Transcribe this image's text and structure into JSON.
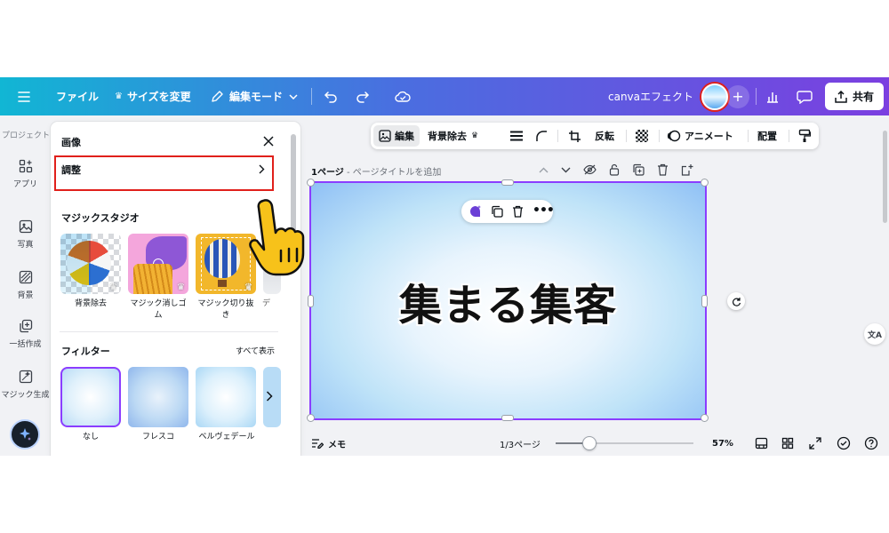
{
  "topbar": {
    "file": "ファイル",
    "resize": "サイズを変更",
    "edit_mode": "編集モード",
    "design_title": "canvaエフェクト",
    "share": "共有"
  },
  "rail": {
    "projects": "プロジェクト",
    "apps": "アプリ",
    "photos": "写真",
    "background": "背景",
    "bulk_create": "一括作成",
    "magic_generate": "マジック生成"
  },
  "panel": {
    "title": "画像",
    "adjust": "調整",
    "magic_studio": "マジックスタジオ",
    "magic_items": [
      "背景除去",
      "マジック消しゴ",
      "ム",
      "マジック切り抜",
      "き",
      "デ"
    ],
    "filters_heading": "フィルター",
    "see_all": "すべて表示",
    "filters": [
      "なし",
      "フレスコ",
      "ベルヴェデール"
    ]
  },
  "float_toolbar": {
    "edit": "編集",
    "bg_remove": "背景除去",
    "flip": "反転",
    "animate": "アニメート",
    "position": "配置"
  },
  "page_header": {
    "label": "1ページ",
    "title_placeholder": "- ページタイトルを追加"
  },
  "canvas": {
    "headline": "集まる集客"
  },
  "status": {
    "notes": "メモ",
    "page_indicator": "1/3ページ",
    "zoom_value": 57,
    "zoom": "57%"
  },
  "colors": {
    "accent": "#8b3dff",
    "highlight": "#e0201b",
    "topbar_start": "#11b6d4",
    "topbar_end": "#7b3fe0"
  }
}
